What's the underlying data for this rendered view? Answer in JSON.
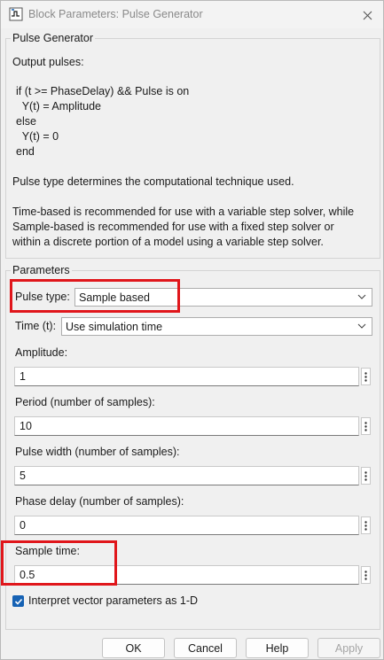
{
  "window": {
    "title": "Block Parameters: Pulse Generator"
  },
  "description_group": {
    "label": "Pulse Generator",
    "intro": "Output pulses:",
    "code_lines": [
      "if (t >= PhaseDelay) && Pulse is on",
      "  Y(t) = Amplitude",
      "else",
      "  Y(t) = 0",
      "end"
    ],
    "pulse_type_note": "Pulse type determines the computational technique used.",
    "recommendation_lines": [
      "Time-based is recommended for use with a variable step solver, while",
      "Sample-based is recommended for use with a fixed step solver or",
      "within a discrete portion of a model using a variable step solver."
    ]
  },
  "parameters": {
    "label": "Parameters",
    "pulse_type": {
      "label": "Pulse type:",
      "value": "Sample based"
    },
    "time": {
      "label": "Time (t):",
      "value": "Use simulation time"
    },
    "amplitude": {
      "label": "Amplitude:",
      "value": "1"
    },
    "period": {
      "label": "Period (number of samples):",
      "value": "10"
    },
    "pulse_width": {
      "label": "Pulse width (number of samples):",
      "value": "5"
    },
    "phase_delay": {
      "label": "Phase delay (number of samples):",
      "value": "0"
    },
    "sample_time": {
      "label": "Sample time:",
      "value": "0.5"
    },
    "interpret_vector": {
      "label": "Interpret vector parameters as 1-D",
      "checked": true
    }
  },
  "buttons": {
    "ok": "OK",
    "cancel": "Cancel",
    "help": "Help",
    "apply": "Apply"
  },
  "colors": {
    "highlight": "#e0161b",
    "checkbox": "#1662b4"
  }
}
